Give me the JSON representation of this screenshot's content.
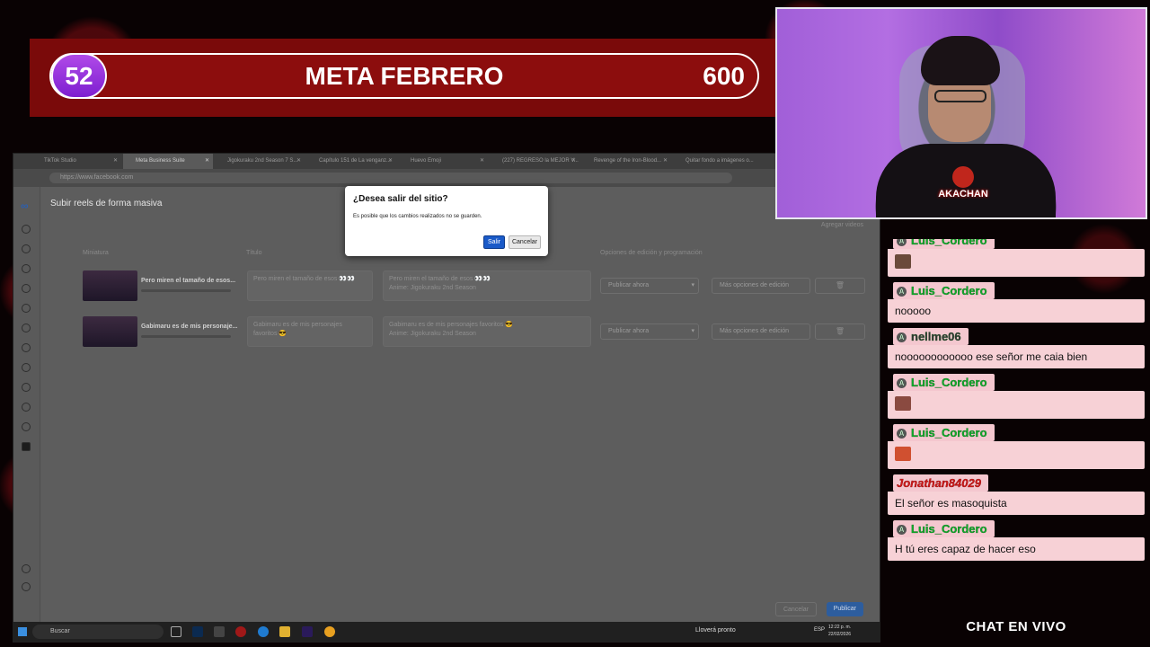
{
  "goal": {
    "current": "52",
    "title": "META FEBRERO",
    "target": "600"
  },
  "browser": {
    "tabs": [
      {
        "label": "TikTok Studio",
        "active": false
      },
      {
        "label": "Meta Business Suite",
        "active": true
      },
      {
        "label": "Jigokuraku 2nd Season 7 S...",
        "active": false
      },
      {
        "label": "Capítulo 151 de La venganz...",
        "active": false
      },
      {
        "label": "Huevo Emoji",
        "active": false
      },
      {
        "label": "(227) REGRESO la MEJOR V...",
        "active": false
      },
      {
        "label": "Revenge of the Iron-Blood...",
        "active": false
      },
      {
        "label": "Quitar fondo a imágenes o...",
        "active": false
      }
    ],
    "url": "https://www.facebook.com"
  },
  "page": {
    "title": "Subir reels de forma masiva",
    "add_videos": "Agregar videos",
    "columns": {
      "thumbnail": "Miniatura",
      "title": "Título",
      "options": "Opciones de edición y programación"
    },
    "rows": [
      {
        "name": "Pero miren el tamaño de esos...",
        "title_value": "Pero miren el tamaño de esos 👀👀",
        "desc_line1": "Pero miren el tamaño de esos 👀👀",
        "desc_line2": "Anime: Jigokuraku 2nd Season",
        "publish": "Publicar ahora",
        "more": "Más opciones de edición"
      },
      {
        "name": "Gabimaru es de mis personaje...",
        "title_value": "Gabimaru es de mis personajes favoritos 😎",
        "desc_line1": "Gabimaru es de mis personajes favoritos 😎",
        "desc_line2": "Anime: Jigokuraku 2nd Season",
        "publish": "Publicar ahora",
        "more": "Más opciones de edición"
      }
    ],
    "footer": {
      "cancel": "Cancelar",
      "publish": "Publicar"
    }
  },
  "dialog": {
    "title": "¿Desea salir del sitio?",
    "message": "Es posible que los cambios realizados no se guarden.",
    "leave": "Salir",
    "cancel": "Cancelar"
  },
  "taskbar": {
    "search": "Buscar",
    "weather": "Lloverá pronto",
    "lang": "ESP",
    "time": "12:22 p. m.",
    "date": "22/02/2026"
  },
  "webcam": {
    "logo": "AKACHAN"
  },
  "chat": {
    "title": "CHAT EN VIVO",
    "messages": [
      {
        "user": "Luis_Cordero",
        "text": "",
        "style": "green",
        "emoji_color": "#6b4a3a"
      },
      {
        "user": "Luis_Cordero",
        "text": "nooooo",
        "style": "green",
        "emoji_color": ""
      },
      {
        "user": "nellme06",
        "text": "noooooooooooo ese señor me caia bien",
        "style": "dark",
        "emoji_color": ""
      },
      {
        "user": "Luis_Cordero",
        "text": "",
        "style": "green",
        "emoji_color": "#8a4a40"
      },
      {
        "user": "Luis_Cordero",
        "text": "",
        "style": "green",
        "emoji_color": "#d05030"
      },
      {
        "user": "Jonathan84029",
        "text": "El señor es masoquista",
        "style": "red",
        "emoji_color": ""
      },
      {
        "user": "Luis_Cordero",
        "text": "H tú eres capaz de hacer eso",
        "style": "green",
        "emoji_color": ""
      }
    ]
  }
}
